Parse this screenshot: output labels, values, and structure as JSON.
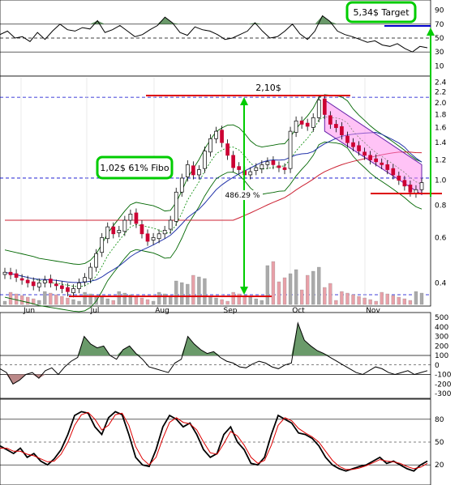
{
  "chart_data": [
    {
      "panel": "rsi",
      "type": "line",
      "y_ticks": [
        "90",
        "70",
        "50",
        "30",
        "10"
      ],
      "reference_lines": [
        70,
        50,
        30
      ],
      "ylim": [
        0,
        100
      ],
      "series": [
        {
          "color": "#000000",
          "values": [
            55,
            60,
            50,
            52,
            45,
            58,
            48,
            60,
            70,
            62,
            60,
            65,
            63,
            75,
            58,
            62,
            68,
            60,
            52,
            55,
            62,
            68,
            80,
            72,
            58,
            54,
            66,
            62,
            60,
            55,
            48,
            50,
            55,
            60,
            72,
            60,
            50,
            52,
            60,
            70,
            56,
            48,
            60,
            82,
            74,
            60,
            55,
            52,
            48,
            44,
            46,
            40,
            38,
            42,
            35,
            30,
            38,
            36
          ]
        }
      ],
      "fills": {
        "above_70": "#6a9a6a"
      }
    },
    {
      "panel": "price",
      "type": "candlestick",
      "scale": "log",
      "ylim": [
        0.33,
        2.5
      ],
      "y_ticks": [
        "2.4",
        "2.2",
        "2.0",
        "1.8",
        "1.6",
        "1.4",
        "1.2",
        "1.0",
        "0.8",
        "0.6",
        "0.4"
      ],
      "x_ticks": [
        "Jun",
        "Jul",
        "Aug",
        "Sep",
        "Oct",
        "Nov"
      ],
      "colors": {
        "up": "#ffffff",
        "down": "#cc0033",
        "upper_band": "#006600",
        "lower_band": "#006600",
        "ma50": "#2233aa",
        "ma200": "#cc2233",
        "channel": "#ff88ee",
        "volume": "#aaaaaa",
        "target_arrow": "#00cc00",
        "support_line": "#dd0000",
        "dashed_level": "#0000cc"
      },
      "closes": [
        0.44,
        0.43,
        0.42,
        0.41,
        0.4,
        0.39,
        0.4,
        0.41,
        0.4,
        0.39,
        0.38,
        0.37,
        0.38,
        0.4,
        0.42,
        0.46,
        0.52,
        0.6,
        0.66,
        0.62,
        0.64,
        0.7,
        0.74,
        0.68,
        0.62,
        0.58,
        0.6,
        0.62,
        0.64,
        0.7,
        0.9,
        1.02,
        1.15,
        1.05,
        1.1,
        1.3,
        1.45,
        1.55,
        1.4,
        1.25,
        1.12,
        1.1,
        1.05,
        1.08,
        1.12,
        1.15,
        1.18,
        1.15,
        1.12,
        1.1,
        1.55,
        1.7,
        1.65,
        1.62,
        1.75,
        2.05,
        1.8,
        1.65,
        1.6,
        1.5,
        1.4,
        1.35,
        1.3,
        1.25,
        1.2,
        1.18,
        1.15,
        1.1,
        1.05,
        1.0,
        0.95,
        0.9,
        0.92,
        0.98
      ],
      "annotations": {
        "fibo_label": "1,02$ 61% Fibo",
        "target_label": "5,34$ Target",
        "top_label": "2,10$",
        "gain_label": "486.29 %"
      },
      "levels": {
        "resistance": 2.1,
        "support": 0.36,
        "fibo": 1.02,
        "channel_bottom": 0.88
      }
    },
    {
      "panel": "cci",
      "type": "line",
      "y_ticks": [
        "500",
        "400",
        "300",
        "200",
        "100",
        "0",
        "-100",
        "-200",
        "-300"
      ],
      "reference_lines": [
        100,
        -100
      ],
      "ylim": [
        -300,
        500
      ],
      "series": [
        {
          "color": "#000000",
          "values": [
            -40,
            -80,
            -200,
            -160,
            -100,
            -80,
            -140,
            -60,
            -30,
            -100,
            -20,
            40,
            80,
            300,
            220,
            180,
            200,
            100,
            60,
            160,
            200,
            120,
            60,
            -20,
            -40,
            -60,
            -80,
            20,
            60,
            300,
            220,
            160,
            120,
            140,
            80,
            40,
            20,
            -20,
            -30,
            10,
            40,
            20,
            -20,
            -40,
            0,
            20,
            440,
            260,
            200,
            150,
            120,
            80,
            40,
            0,
            -40,
            -80,
            -100,
            -60,
            -20,
            -40,
            -80,
            -100,
            -80,
            -60,
            -100,
            -80,
            -60
          ]
        }
      ],
      "fills": {
        "positive": "#6a9a6a",
        "negative": "#bb8888"
      }
    },
    {
      "panel": "stochastic",
      "type": "line",
      "y_ticks": [
        "80",
        "50",
        "20"
      ],
      "reference_lines": [
        80,
        20
      ],
      "ylim": [
        0,
        100
      ],
      "series": [
        {
          "color": "#000000",
          "values": [
            45,
            40,
            35,
            42,
            30,
            35,
            25,
            20,
            28,
            40,
            60,
            85,
            90,
            88,
            70,
            60,
            82,
            90,
            86,
            60,
            30,
            20,
            18,
            40,
            70,
            85,
            80,
            70,
            75,
            60,
            40,
            30,
            35,
            60,
            70,
            50,
            40,
            22,
            20,
            30,
            60,
            85,
            80,
            75,
            62,
            60,
            55,
            45,
            30,
            20,
            15,
            12,
            15,
            18,
            20,
            25,
            30,
            22,
            25,
            20,
            15,
            12,
            20,
            25
          ]
        },
        {
          "color": "#dd0000",
          "values": [
            42,
            42,
            38,
            38,
            34,
            32,
            28,
            24,
            25,
            34,
            50,
            72,
            86,
            89,
            80,
            66,
            72,
            86,
            88,
            72,
            44,
            28,
            20,
            30,
            55,
            76,
            82,
            76,
            74,
            66,
            50,
            36,
            34,
            48,
            64,
            58,
            46,
            30,
            22,
            26,
            46,
            72,
            82,
            78,
            68,
            62,
            57,
            50,
            38,
            26,
            18,
            14,
            14,
            16,
            19,
            23,
            27,
            25,
            24,
            22,
            18,
            15,
            17,
            22
          ]
        }
      ]
    }
  ]
}
